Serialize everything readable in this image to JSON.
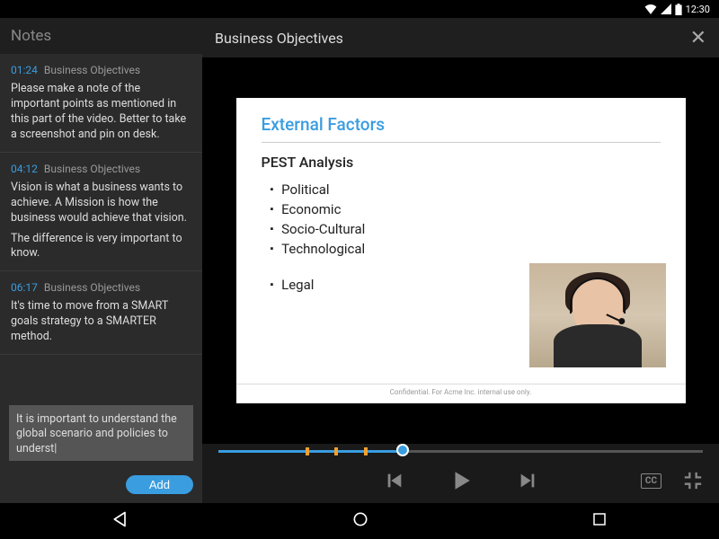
{
  "statusbar": {
    "time": "12:30"
  },
  "sidebar": {
    "title": "Notes",
    "notes": [
      {
        "time": "01:24",
        "title": "Business Objectives",
        "body": [
          "Please make a note of the important points as mentioned in this part of the video. Better to take a screenshot and pin on desk."
        ]
      },
      {
        "time": "04:12",
        "title": "Business Objectives",
        "body": [
          "Vision is what a business wants to achieve. A Mission is how the business would achieve that  vision.",
          "The difference is very important to know."
        ]
      },
      {
        "time": "06:17",
        "title": "Business Objectives",
        "body": [
          "It's time to move from a SMART goals strategy to a SMARTER method."
        ]
      }
    ],
    "input_value": "It is important to understand the global scenario and policies to underst|",
    "add_label": "Add"
  },
  "main": {
    "title": "Business Objectives",
    "slide": {
      "title": "External Factors",
      "subtitle": "PEST Analysis",
      "items": [
        "Political",
        "Economic",
        "Socio-Cultural",
        "Technological",
        "Legal"
      ],
      "footer": "Confidential. For Acme Inc. internal use only."
    },
    "progress": {
      "percent": 38,
      "markers_pct": [
        18,
        24,
        30
      ]
    }
  },
  "controls": {
    "cc_label": "CC"
  }
}
